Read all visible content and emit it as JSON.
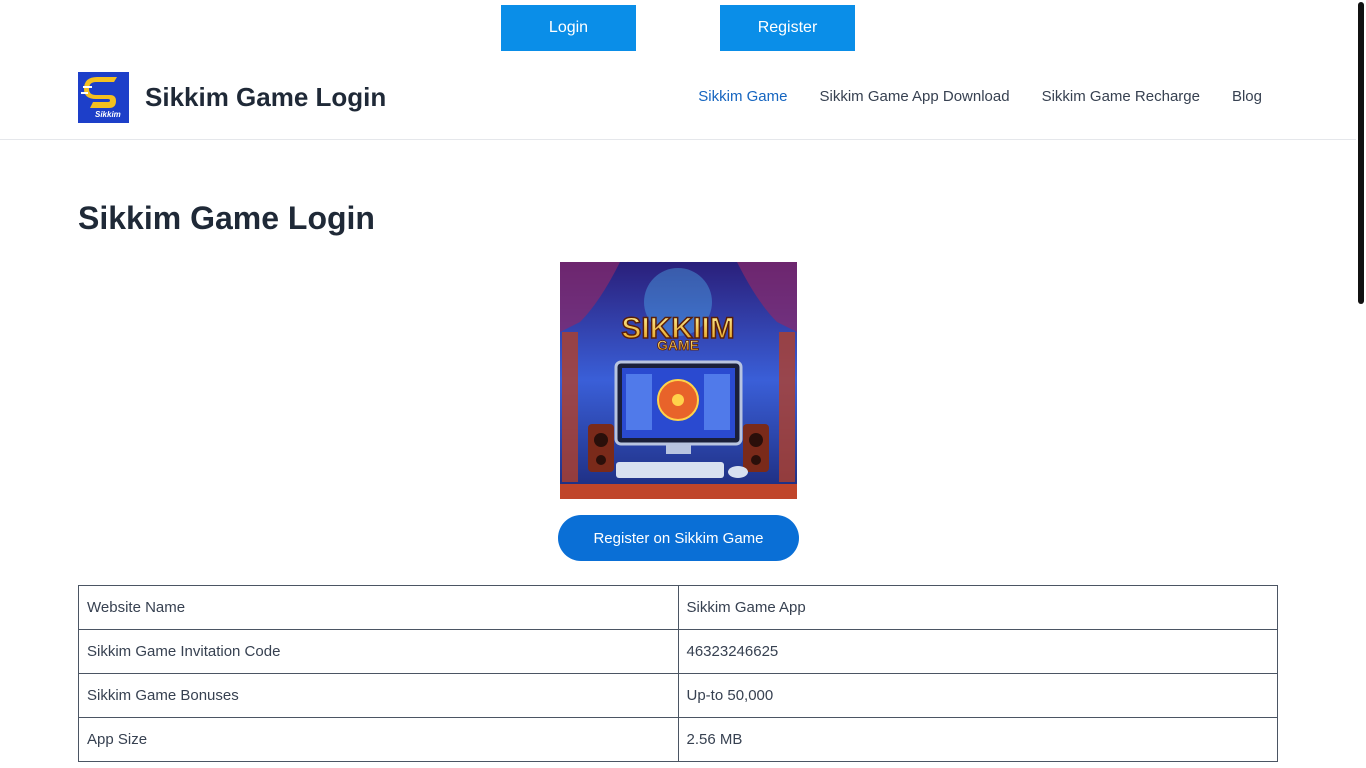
{
  "top_buttons": {
    "login_label": "Login",
    "register_label": "Register"
  },
  "header": {
    "site_title": "Sikkim Game Login",
    "logo_text": "Sikkim",
    "nav": [
      {
        "label": "Sikkim Game",
        "active": true
      },
      {
        "label": "Sikkim Game App Download",
        "active": false
      },
      {
        "label": "Sikkim Game Recharge",
        "active": false
      },
      {
        "label": "Blog",
        "active": false
      }
    ]
  },
  "main": {
    "title": "Sikkim Game Login",
    "hero_image_text": {
      "line1": "SIKKIIM",
      "line2": "GAME"
    },
    "cta_label": "Register on Sikkim Game",
    "info_table": [
      {
        "label": "Website Name",
        "value": "Sikkim Game App"
      },
      {
        "label": "Sikkim Game Invitation Code",
        "value": "46323246625"
      },
      {
        "label": "Sikkim Game Bonuses",
        "value": "Up-to 50,000"
      },
      {
        "label": "App Size",
        "value": "2.56 MB"
      }
    ]
  },
  "colors": {
    "primary_button": "#0a8ee8",
    "cta_button": "#0a6fd6",
    "nav_active": "#1565c0"
  }
}
